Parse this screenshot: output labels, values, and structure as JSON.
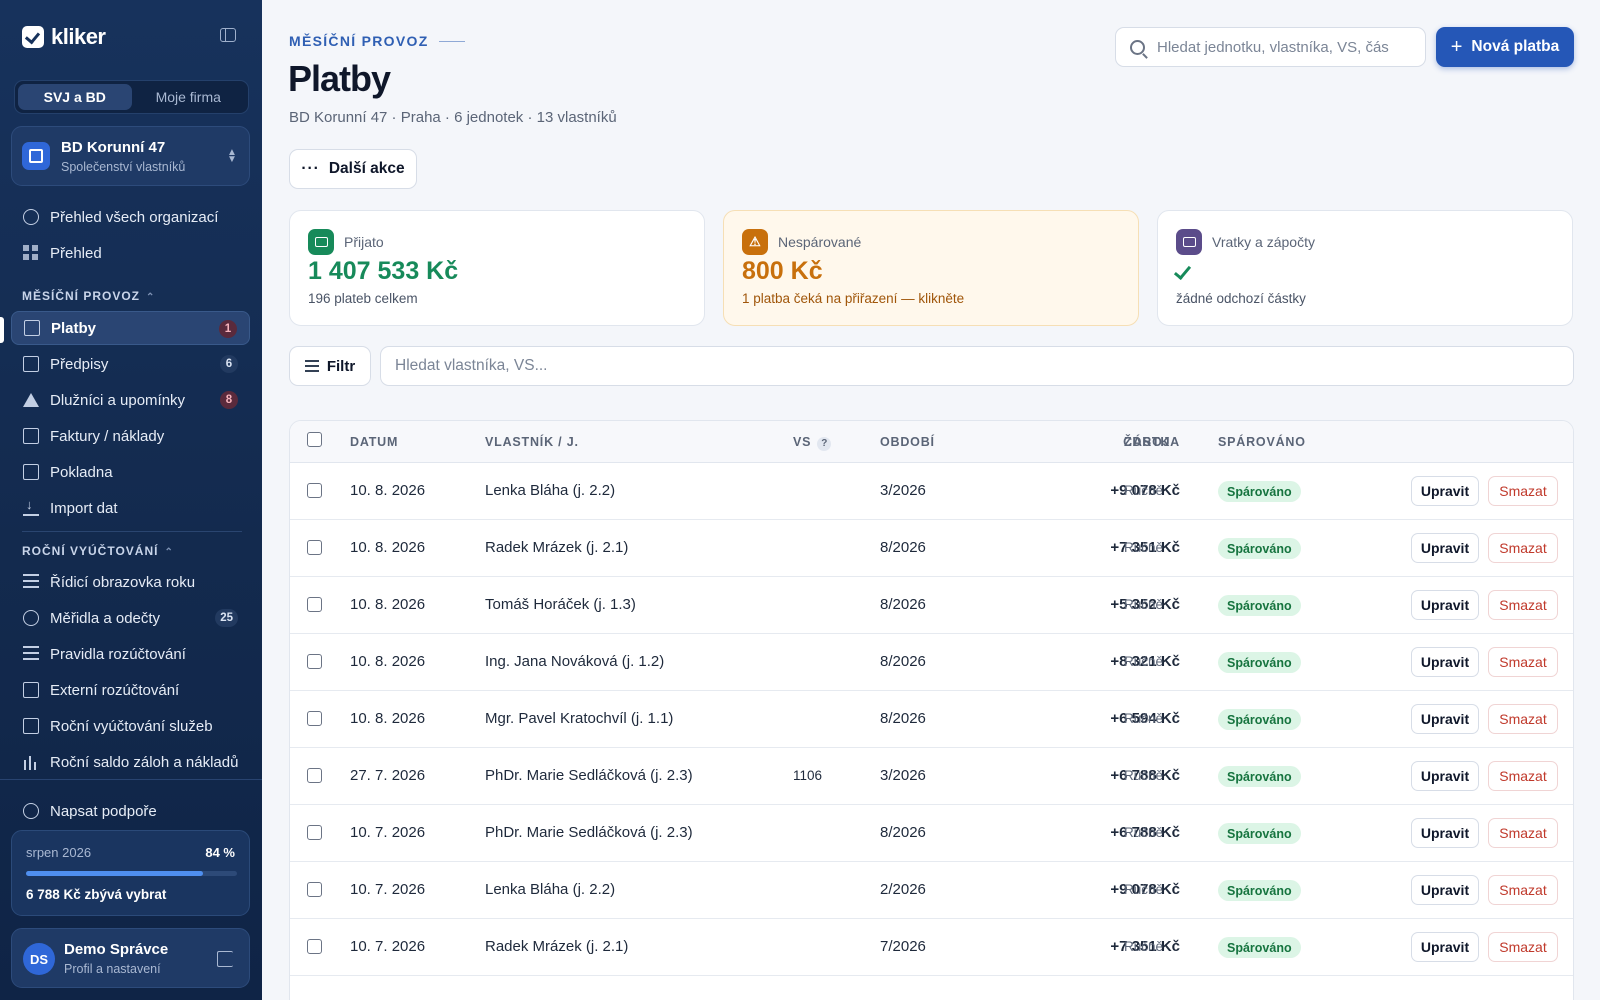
{
  "app": {
    "logo_text": "kliker"
  },
  "sidebar": {
    "segments": [
      "SVJ a BD",
      "Moje firma"
    ],
    "org": {
      "name": "BD Korunní 47",
      "type": "Společenství vlastníků"
    },
    "top_items": [
      {
        "label": "Přehled všech organizací"
      },
      {
        "label": "Přehled"
      }
    ],
    "section_monthly": "MĚSÍČNÍ PROVOZ",
    "monthly_items": [
      {
        "label": "Platby",
        "badge": "1"
      },
      {
        "label": "Předpisy",
        "badge": "6"
      },
      {
        "label": "Dlužníci a upomínky",
        "badge": "8"
      },
      {
        "label": "Faktury / náklady"
      },
      {
        "label": "Pokladna"
      },
      {
        "label": "Import dat"
      }
    ],
    "section_annual": "ROČNÍ VYÚČTOVÁNÍ",
    "annual_items": [
      {
        "label": "Řídicí obrazovka roku"
      },
      {
        "label": "Měřidla a odečty",
        "badge": "25"
      },
      {
        "label": "Pravidla rozúčtování"
      },
      {
        "label": "Externí rozúčtování"
      },
      {
        "label": "Roční vyúčtování služeb"
      },
      {
        "label": "Roční saldo záloh a nákladů"
      }
    ],
    "support": "Napsat podpoře",
    "progress": {
      "month": "srpen 2026",
      "percent_label": "84 %",
      "fraction": 0.84,
      "remaining": "6 788 Kč zbývá vybrat"
    },
    "user": {
      "initials": "DS",
      "name": "Demo Správce",
      "sub": "Profil a nastavení"
    }
  },
  "header": {
    "eyebrow": "MĚSÍČNÍ PROVOZ",
    "title": "Platby",
    "subtitle": "BD Korunní 47 · Praha · 6 jednotek · 13 vlastníků",
    "search_placeholder": "Hledat jednotku, vlastníka, VS, čás",
    "new_button": "Nová platba",
    "more_button": "Další akce"
  },
  "cards": [
    {
      "label": "Přijato",
      "value": "1 407 533 Kč",
      "sub": "196 plateb celkem",
      "color": "#178a5a"
    },
    {
      "label": "Nespárované",
      "value": "800 Kč",
      "sub": "1 platba čeká na přiřazení — klikněte",
      "color": "#c8700c"
    },
    {
      "label": "Vratky a zápočty",
      "value": "",
      "sub": "žádné odchozí částky",
      "color": "#5b4c8a"
    }
  ],
  "filter": {
    "button": "Filtr",
    "placeholder": "Hledat vlastníka, VS..."
  },
  "table": {
    "columns": {
      "date": "DATUM",
      "owner": "VLASTNÍK / J.",
      "vs": "VS",
      "period": "OBDOBÍ",
      "amount": "ČÁSTKA",
      "source": "ZDROJ",
      "paired": "SPÁROVÁNO"
    },
    "edit_label": "Upravit",
    "delete_label": "Smazat",
    "rows": [
      {
        "date": "10. 8. 2026",
        "owner": "Lenka Bláha (j. 2.2)",
        "vs": "",
        "period": "3/2026",
        "amount": "+9 078 Kč",
        "source": "Ručně",
        "status": "Spárováno"
      },
      {
        "date": "10. 8. 2026",
        "owner": "Radek Mrázek (j. 2.1)",
        "vs": "",
        "period": "8/2026",
        "amount": "+7 351 Kč",
        "source": "Ručně",
        "status": "Spárováno"
      },
      {
        "date": "10. 8. 2026",
        "owner": "Tomáš Horáček (j. 1.3)",
        "vs": "",
        "period": "8/2026",
        "amount": "+5 352 Kč",
        "source": "Ručně",
        "status": "Spárováno"
      },
      {
        "date": "10. 8. 2026",
        "owner": "Ing. Jana Nováková (j. 1.2)",
        "vs": "",
        "period": "8/2026",
        "amount": "+8 321 Kč",
        "source": "Ručně",
        "status": "Spárováno"
      },
      {
        "date": "10. 8. 2026",
        "owner": "Mgr. Pavel Kratochvíl (j. 1.1)",
        "vs": "",
        "period": "8/2026",
        "amount": "+6 594 Kč",
        "source": "Ručně",
        "status": "Spárováno"
      },
      {
        "date": "27. 7. 2026",
        "owner": "PhDr. Marie Sedláčková (j. 2.3)",
        "vs": "1106",
        "period": "3/2026",
        "amount": "+6 788 Kč",
        "source": "Ručně",
        "status": "Spárováno"
      },
      {
        "date": "10. 7. 2026",
        "owner": "PhDr. Marie Sedláčková (j. 2.3)",
        "vs": "",
        "period": "8/2026",
        "amount": "+6 788 Kč",
        "source": "Ručně",
        "status": "Spárováno"
      },
      {
        "date": "10. 7. 2026",
        "owner": "Lenka Bláha (j. 2.2)",
        "vs": "",
        "period": "2/2026",
        "amount": "+9 078 Kč",
        "source": "Ručně",
        "status": "Spárováno"
      },
      {
        "date": "10. 7. 2026",
        "owner": "Radek Mrázek (j. 2.1)",
        "vs": "",
        "period": "7/2026",
        "amount": "+7 351 Kč",
        "source": "Ručně",
        "status": "Spárováno"
      }
    ]
  }
}
